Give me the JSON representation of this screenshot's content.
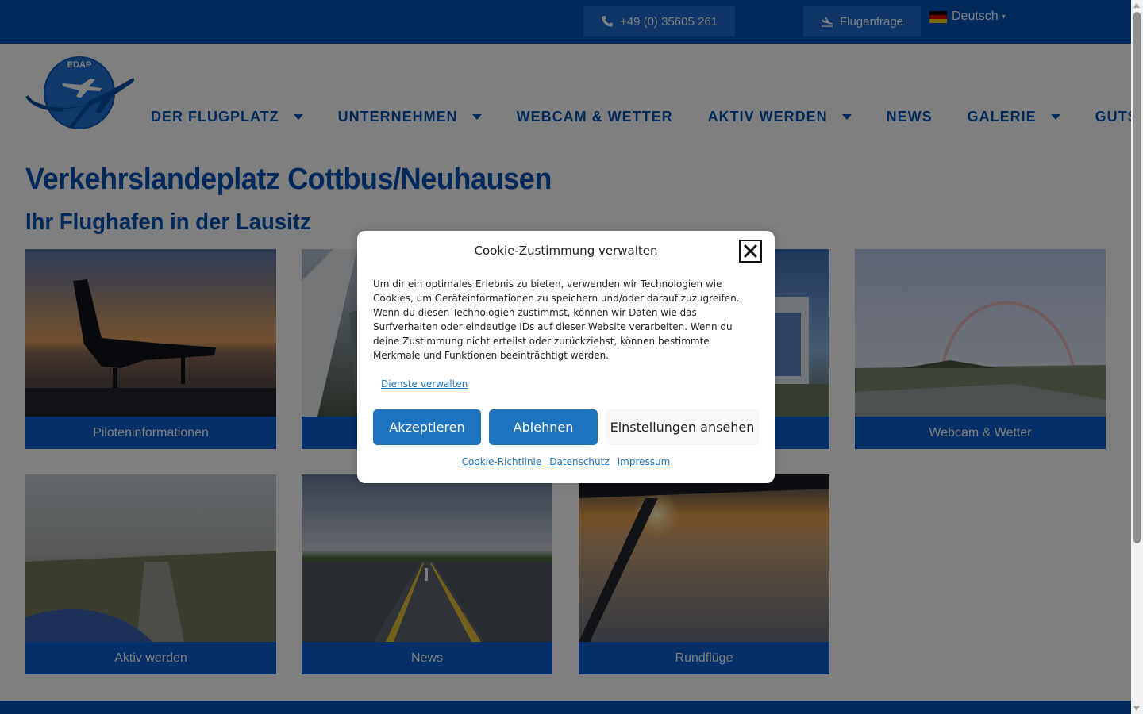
{
  "topbar": {
    "phone": "+49 (0) 35605 261",
    "flight_request": "Fluganfrage",
    "language": "Deutsch",
    "language_caret": "▾"
  },
  "logo": {
    "text": "EDAP"
  },
  "nav": {
    "items": [
      {
        "label": "DER FLUGPLATZ",
        "dropdown": true
      },
      {
        "label": "UNTERNEHMEN",
        "dropdown": true
      },
      {
        "label": "WEBCAM & WETTER",
        "dropdown": false
      },
      {
        "label": "AKTIV WERDEN",
        "dropdown": true
      },
      {
        "label": "NEWS",
        "dropdown": false
      },
      {
        "label": "GALERIE",
        "dropdown": true
      },
      {
        "label": "GUTSCHEINE",
        "dropdown": false
      }
    ]
  },
  "main": {
    "title": "Verkehrslandeplatz Cottbus/Neuhausen",
    "subtitle": "Ihr Flughafen in der Lausitz",
    "tiles": [
      {
        "label": "Piloteninformationen"
      },
      {
        "label": ""
      },
      {
        "label": ""
      },
      {
        "label": "Webcam & Wetter"
      },
      {
        "label": "Aktiv werden"
      },
      {
        "label": "News"
      },
      {
        "label": "Rundflüge"
      }
    ]
  },
  "cookie_modal": {
    "title": "Cookie-Zustimmung verwalten",
    "text": "Um dir ein optimales Erlebnis zu bieten, verwenden wir Technologien wie Cookies, um Geräteinformationen zu speichern und/oder darauf zuzugreifen. Wenn du diesen Technologien zustimmst, können wir Daten wie das Surfverhalten oder eindeutige IDs auf dieser Website verarbeiten. Wenn du deine Zustimmung nicht erteilst oder zurückziehst, können bestimmte Merkmale und Funktionen beeinträchtigt werden.",
    "manage_services": "Dienste verwalten",
    "accept": "Akzeptieren",
    "deny": "Ablehnen",
    "view_settings": "Einstellungen ansehen",
    "links": [
      "Cookie-Richtlinie",
      "Datenschutz",
      "Impressum"
    ]
  },
  "colors": {
    "brand_blue": "#0553b8",
    "tile_caption": "#0a5fd0",
    "button_blue": "#1e73be"
  },
  "icons": {
    "phone": "phone-icon",
    "flight": "plane-landing-icon",
    "close": "close-icon",
    "flag": "german-flag-icon"
  }
}
